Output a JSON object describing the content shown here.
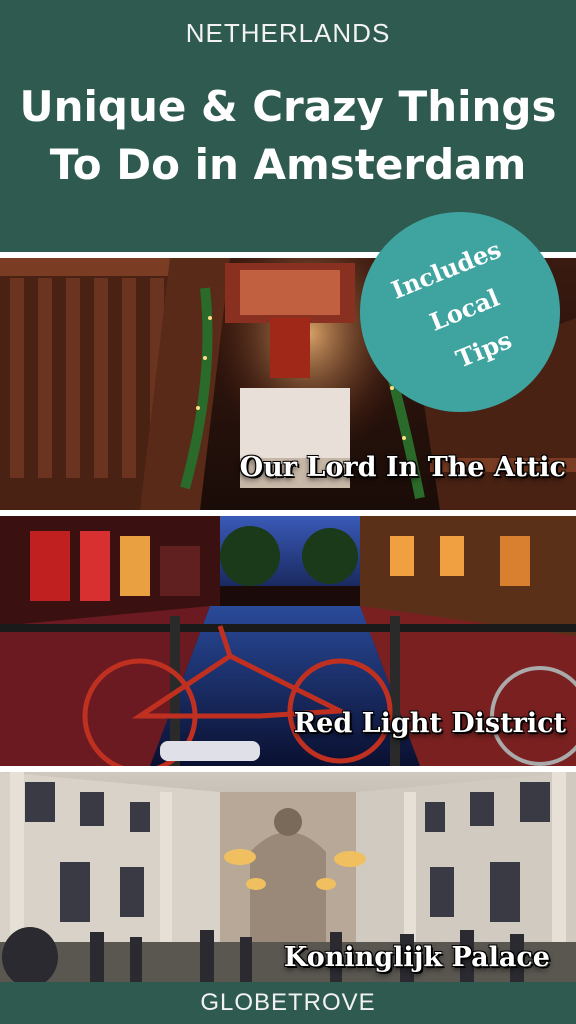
{
  "header": {
    "country": "NETHERLANDS",
    "title_line1": "Unique & Crazy Things",
    "title_line2": "To Do in Amsterdam"
  },
  "badge": {
    "line1": "Includes",
    "line2": "Local",
    "line3": "Tips"
  },
  "photos": [
    {
      "caption": "Our Lord In The Attic",
      "icon": "church-altar-photo"
    },
    {
      "caption": "Red Light District",
      "icon": "canal-bicycle-photo"
    },
    {
      "caption": "Koninglijk Palace",
      "icon": "palace-hall-photo"
    }
  ],
  "footer": {
    "brand": "GLOBETROVE"
  },
  "colors": {
    "header_bg": "#2e5a50",
    "badge_bg": "#3fa3a0",
    "text": "#ffffff"
  }
}
